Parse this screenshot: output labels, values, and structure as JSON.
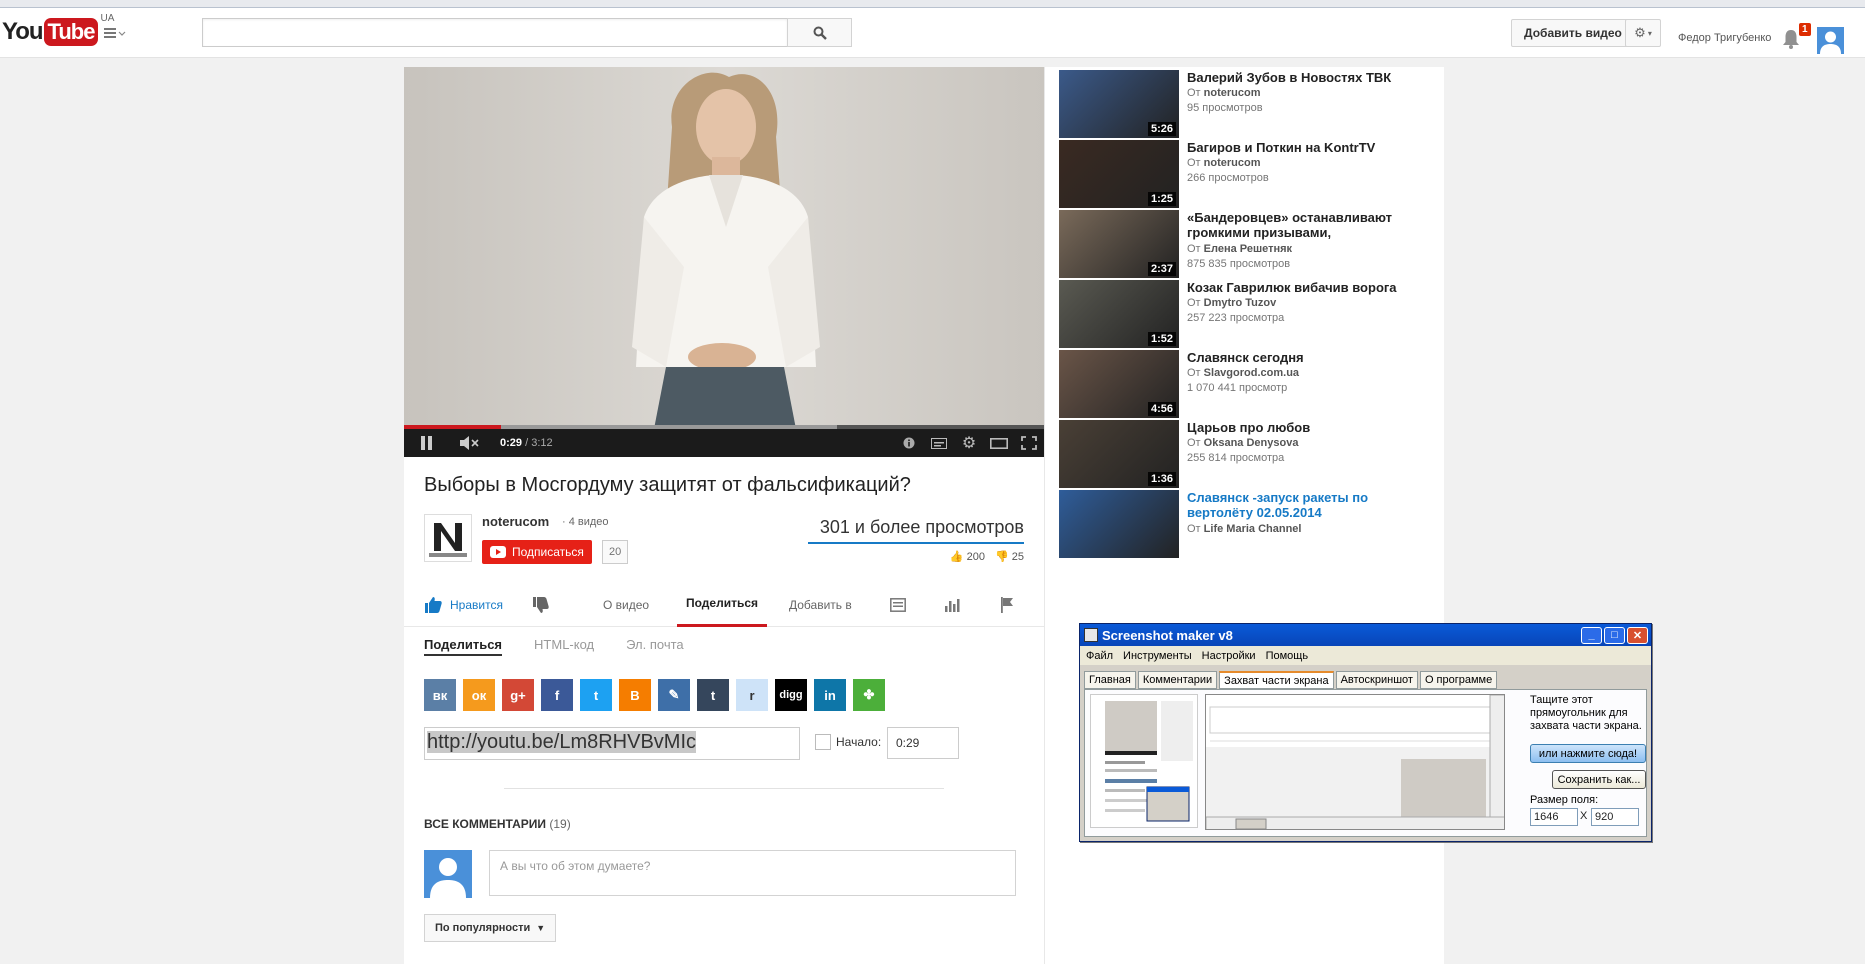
{
  "masthead": {
    "logo_you": "You",
    "logo_tube": "Tube",
    "logo_region": "UA",
    "search_placeholder": "",
    "upload_label": "Добавить видео",
    "user_name": "Федор Тригубенко",
    "notification_count": "1"
  },
  "player": {
    "time_current": "0:29",
    "time_separator": " / ",
    "time_duration": "3:12",
    "progress_played_fraction": 0.151,
    "progress_buffered_fraction": 0.677
  },
  "video": {
    "title": "Выборы в Мосгордуму защитят от фальсификаций?",
    "channel_name": "noterucom",
    "channel_videos": "· 4 видео",
    "subscribe_label": "Подписаться",
    "subscriber_count": "20",
    "views": "301 и более просмотров",
    "likes": "200",
    "dislikes": "25",
    "actions": {
      "like": "Нравится",
      "about": "О видео",
      "share": "Поделиться",
      "add_to": "Добавить в"
    }
  },
  "share": {
    "tabs": [
      "Поделиться",
      "HTML-код",
      "Эл. почта"
    ],
    "url": "http://youtu.be/Lm8RHVBvMIc",
    "start_label": "Начало:",
    "start_time": "0:29",
    "social": [
      {
        "name": "vk",
        "glyph": "вк",
        "color": "#5b7fa6"
      },
      {
        "name": "odnoklassniki",
        "glyph": "ок",
        "color": "#f59a1d"
      },
      {
        "name": "google-plus",
        "glyph": "g+",
        "color": "#d34836"
      },
      {
        "name": "facebook",
        "glyph": "f",
        "color": "#3b5998"
      },
      {
        "name": "twitter",
        "glyph": "t",
        "color": "#1da1f2"
      },
      {
        "name": "blogger",
        "glyph": "B",
        "color": "#f57d00"
      },
      {
        "name": "livejournal",
        "glyph": "✎",
        "color": "#3e6fa8"
      },
      {
        "name": "tumblr",
        "glyph": "t",
        "color": "#35465c"
      },
      {
        "name": "reddit",
        "glyph": "r",
        "color": "#cee3f8"
      },
      {
        "name": "digg",
        "glyph": "digg",
        "color": "#000000"
      },
      {
        "name": "linkedin",
        "glyph": "in",
        "color": "#0e76a8"
      },
      {
        "name": "stumbleupon",
        "glyph": "✤",
        "color": "#4caf3a"
      }
    ]
  },
  "comments": {
    "header": "ВСЕ КОММЕНТАРИИ",
    "count": "(19)",
    "placeholder": "А вы что об этом думаете?",
    "sort_label": "По популярности"
  },
  "sidebar": {
    "from_label": "От",
    "items": [
      {
        "title": "Валерий Зубов в Новостях ТВК",
        "author": "noterucom",
        "views": "95 просмотров",
        "duration": "5:26",
        "color": "#3b5a8a"
      },
      {
        "title": "Багиров и Поткин на KontrTV",
        "author": "noterucom",
        "views": "266 просмотров",
        "duration": "1:25",
        "color": "#3a2a22"
      },
      {
        "title": "«Бандеровцев» останавливают громкими призывами,",
        "author": "Елена Решетняк",
        "views": "875 835 просмотров",
        "duration": "2:37",
        "color": "#7a6a5a"
      },
      {
        "title": "Козак Гаврилюк вибачив ворога",
        "author": "Dmytro Tuzov",
        "views": "257 223 просмотра",
        "duration": "1:52",
        "color": "#5a5a52"
      },
      {
        "title": "Славянск сегодня",
        "author": "Slavgorod.com.ua",
        "views": "1 070 441 просмотр",
        "duration": "4:56",
        "color": "#6a5548"
      },
      {
        "title": "Царьов про любов",
        "author": "Oksana Denysova",
        "views": "255 814 просмотра",
        "duration": "1:36",
        "color": "#4a4036"
      },
      {
        "title": "Славянск -запуск ракеты по вертолёту 02.05.2014",
        "author": "Life Maria Channel",
        "views": "",
        "duration": "",
        "color": "#2f5d9a"
      }
    ]
  },
  "screenshot_maker": {
    "title": "Screenshot maker v8",
    "menu": [
      "Файл",
      "Инструменты",
      "Настройки",
      "Помощь"
    ],
    "tabs": [
      "Главная",
      "Комментарии",
      "Захват части экрана",
      "Автоскриншот",
      "О программе"
    ],
    "hint": "Тащите этот прямоугольник для захвата части экрана.",
    "click_here": "или нажмите сюда!",
    "save_as": "Сохранить как...",
    "size_label": "Размер поля:",
    "width": "1646",
    "x": "X",
    "height": "920"
  }
}
